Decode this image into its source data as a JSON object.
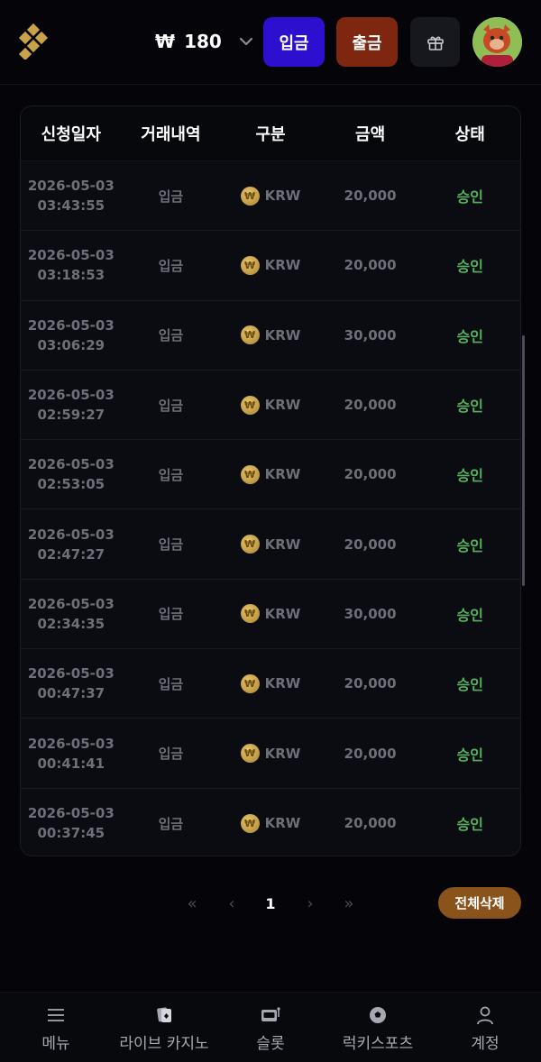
{
  "header": {
    "currency_symbol": "₩",
    "balance": "180",
    "deposit_label": "입금",
    "withdraw_label": "출금"
  },
  "table": {
    "columns": [
      "신청일자",
      "거래내역",
      "구분",
      "금액",
      "상태"
    ],
    "rows": [
      {
        "date": "2026-05-03",
        "time": "03:43:55",
        "type": "입금",
        "currency": "KRW",
        "amount": "20,000",
        "status": "승인"
      },
      {
        "date": "2026-05-03",
        "time": "03:18:53",
        "type": "입금",
        "currency": "KRW",
        "amount": "20,000",
        "status": "승인"
      },
      {
        "date": "2026-05-03",
        "time": "03:06:29",
        "type": "입금",
        "currency": "KRW",
        "amount": "30,000",
        "status": "승인"
      },
      {
        "date": "2026-05-03",
        "time": "02:59:27",
        "type": "입금",
        "currency": "KRW",
        "amount": "20,000",
        "status": "승인"
      },
      {
        "date": "2026-05-03",
        "time": "02:53:05",
        "type": "입금",
        "currency": "KRW",
        "amount": "20,000",
        "status": "승인"
      },
      {
        "date": "2026-05-03",
        "time": "02:47:27",
        "type": "입금",
        "currency": "KRW",
        "amount": "20,000",
        "status": "승인"
      },
      {
        "date": "2026-05-03",
        "time": "02:34:35",
        "type": "입금",
        "currency": "KRW",
        "amount": "30,000",
        "status": "승인"
      },
      {
        "date": "2026-05-03",
        "time": "00:47:37",
        "type": "입금",
        "currency": "KRW",
        "amount": "20,000",
        "status": "승인"
      },
      {
        "date": "2026-05-03",
        "time": "00:41:41",
        "type": "입금",
        "currency": "KRW",
        "amount": "20,000",
        "status": "승인"
      },
      {
        "date": "2026-05-03",
        "time": "00:37:45",
        "type": "입금",
        "currency": "KRW",
        "amount": "20,000",
        "status": "승인"
      }
    ]
  },
  "pagination": {
    "first": "«",
    "prev": "‹",
    "current_page": "1",
    "next": "›",
    "last": "»",
    "delete_all_label": "전체삭제"
  },
  "bottom_nav": [
    {
      "label": "메뉴",
      "icon": "menu-icon"
    },
    {
      "label": "라이브 카지노",
      "icon": "cards-icon"
    },
    {
      "label": "슬롯",
      "icon": "slot-machine-icon"
    },
    {
      "label": "럭키스포츠",
      "icon": "soccer-ball-icon"
    },
    {
      "label": "계정",
      "icon": "user-icon"
    }
  ],
  "colors": {
    "deposit_button": "#2d10cf",
    "withdraw_button": "#7e260f",
    "approved_status": "#55b35f",
    "delete_all_button": "#8a531c",
    "coin": "#c9a24a"
  }
}
